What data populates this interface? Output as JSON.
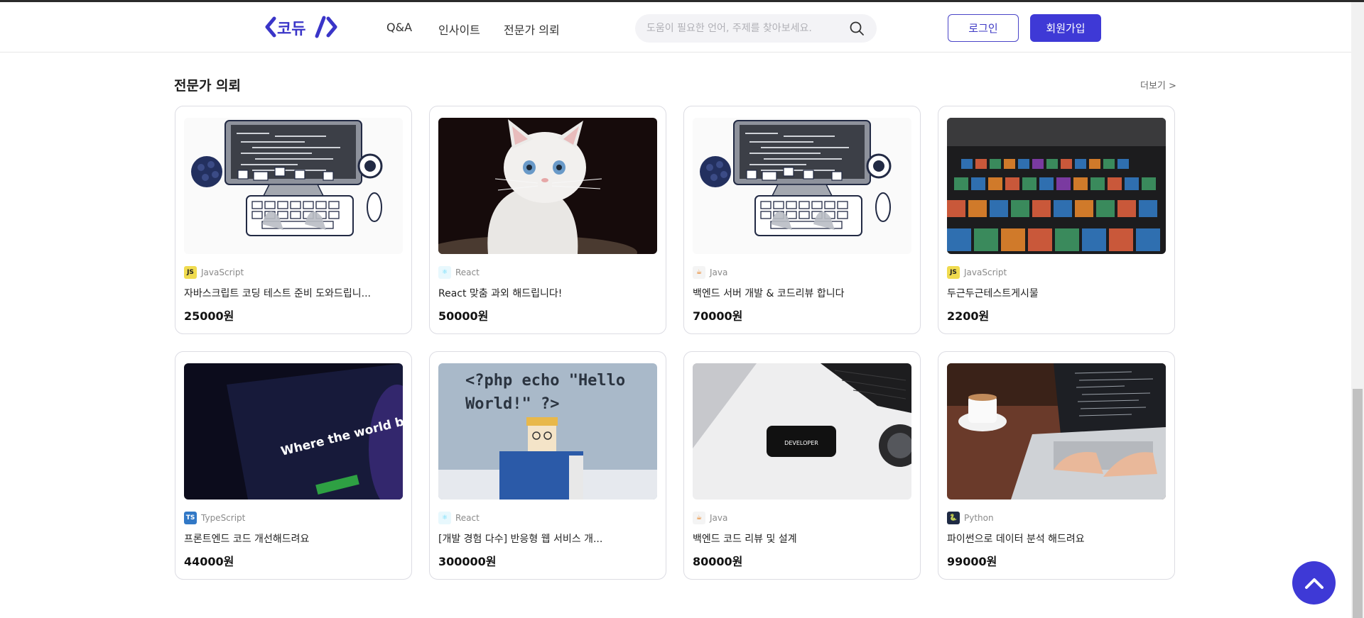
{
  "header": {
    "logo_text": "<코듀/>",
    "nav": [
      "Q&A",
      "인사이트",
      "전문가 의뢰"
    ],
    "search": {
      "placeholder": "도움이 필요한 언어, 주제를 찾아보세요."
    },
    "login_label": "로그인",
    "signup_label": "회원가입"
  },
  "section": {
    "title": "전문가 의뢰",
    "more_label": "더보기 >"
  },
  "cards": [
    {
      "image": "coding-illustration",
      "lang": "JavaScript",
      "lang_badge": "JS",
      "title": "자바스크립트 코딩 테스트 준비 도와드립니...",
      "price": "25000원"
    },
    {
      "image": "white-kitten-photo",
      "lang": "React",
      "lang_badge": "⚛",
      "title": "React 맞춤 과외 해드립니다!",
      "price": "50000원"
    },
    {
      "image": "coding-illustration",
      "lang": "Java",
      "lang_badge": "☕",
      "title": "백엔드 서버 개발 & 코드리뷰 합니다",
      "price": "70000원"
    },
    {
      "image": "theater-seats-photo",
      "lang": "JavaScript",
      "lang_badge": "JS",
      "title": "두근두근테스트게시물",
      "price": "2200원"
    },
    {
      "image": "github-laptop-photo",
      "lang": "TypeScript",
      "lang_badge": "TS",
      "title": "프론트엔드 코드 개선해드려요",
      "price": "44000원"
    },
    {
      "image": "php-hello-world-photo",
      "lang": "React",
      "lang_badge": "⚛",
      "title": "[개발 경험 다수] 반응형 웹 서비스 개...",
      "price": "300000원"
    },
    {
      "image": "developer-phone-photo",
      "lang": "Java",
      "lang_badge": "☕",
      "title": "백엔드 코드 리뷰 및 설계",
      "price": "80000원"
    },
    {
      "image": "laptop-coffee-photo",
      "lang": "Python",
      "lang_badge": "🐍",
      "title": "파이썬으로 데이터 분석 해드려요",
      "price": "99000원"
    }
  ],
  "image_text": {
    "github_headline": "Where the world builds software",
    "php_code": "<?php echo \"Hello World!\" ?>",
    "phone_text": "DEVELOPER"
  },
  "colors": {
    "accent": "#3e39d6",
    "js": "#f0db4f",
    "ts": "#3178c6",
    "react": "#61dafb",
    "python": "#3776ab"
  }
}
